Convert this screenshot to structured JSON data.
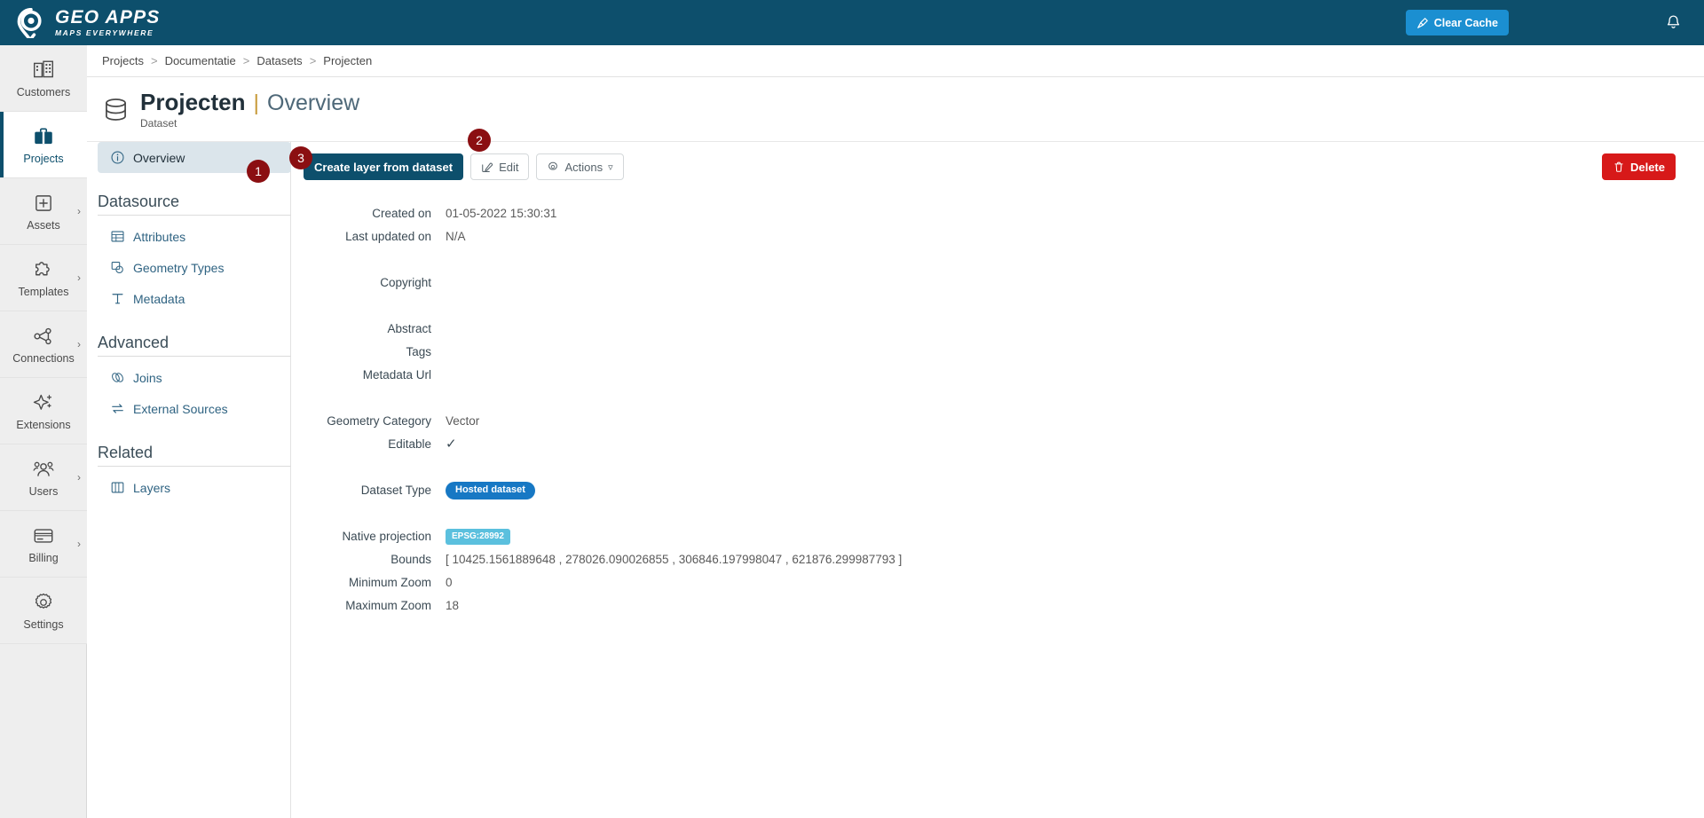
{
  "topbar": {
    "logo_main": "GEO APPS",
    "logo_sub": "MAPS EVERYWHERE",
    "logo_icon": "map-pin-icon",
    "clear_cache_label": "Clear Cache",
    "clear_cache_icon": "broom-icon",
    "clear_cache_color": "#1b8fd1",
    "bell_icon": "notification-bell-icon",
    "background_color": "#0d4f6c"
  },
  "rail": {
    "items": [
      {
        "label": "Customers",
        "icon": "buildings-icon",
        "active": false,
        "chevron": false
      },
      {
        "label": "Projects",
        "icon": "briefcase-icon",
        "active": true,
        "chevron": false
      },
      {
        "label": "Assets",
        "icon": "plus-square-icon",
        "active": false,
        "chevron": true
      },
      {
        "label": "Templates",
        "icon": "puzzle-piece-icon",
        "active": false,
        "chevron": true
      },
      {
        "label": "Connections",
        "icon": "nodes-graph-icon",
        "active": false,
        "chevron": true
      },
      {
        "label": "Extensions",
        "icon": "sparkle-plus-icon",
        "active": false,
        "chevron": false
      },
      {
        "label": "Users",
        "icon": "users-group-icon",
        "active": false,
        "chevron": true
      },
      {
        "label": "Billing",
        "icon": "credit-card-icon",
        "active": false,
        "chevron": true
      },
      {
        "label": "Settings",
        "icon": "gear-icon",
        "active": false,
        "chevron": false
      }
    ]
  },
  "breadcrumb": {
    "separator": ">",
    "items": [
      "Projects",
      "Documentatie",
      "Datasets",
      "Projecten"
    ]
  },
  "page_header": {
    "icon": "database-cylinder-icon",
    "title": "Projecten",
    "divider": "|",
    "section": "Overview",
    "subtitle": "Dataset"
  },
  "subnav": {
    "groups": [
      {
        "heading": null,
        "items": [
          {
            "label": "Overview",
            "icon": "info-circle-icon",
            "active": true
          }
        ]
      },
      {
        "heading": "Datasource",
        "items": [
          {
            "label": "Attributes",
            "icon": "table-icon",
            "active": false
          },
          {
            "label": "Geometry Types",
            "icon": "shapes-icon",
            "active": false
          },
          {
            "label": "Metadata",
            "icon": "text-t-icon",
            "active": false
          }
        ]
      },
      {
        "heading": "Advanced",
        "items": [
          {
            "label": "Joins",
            "icon": "link-chain-icon",
            "active": false
          },
          {
            "label": "External Sources",
            "icon": "exchange-arrows-icon",
            "active": false
          }
        ]
      },
      {
        "heading": "Related",
        "items": [
          {
            "label": "Layers",
            "icon": "layers-icon",
            "active": false
          }
        ]
      }
    ]
  },
  "toolbar": {
    "create_layer_label": "Create layer from dataset",
    "edit_label": "Edit",
    "edit_icon": "pencil-square-icon",
    "actions_label": "Actions",
    "actions_icon": "gear-icon",
    "actions_caret": "▿",
    "delete_label": "Delete",
    "delete_icon": "trash-icon",
    "delete_color": "#d71919",
    "primary_color": "#0d4f6c"
  },
  "badges": [
    {
      "id": "badge1",
      "text": "1"
    },
    {
      "id": "badge2",
      "text": "2"
    },
    {
      "id": "badge3",
      "text": "3"
    }
  ],
  "details": {
    "created_on_label": "Created on",
    "created_on_value": "01-05-2022 15:30:31",
    "last_updated_label": "Last updated on",
    "last_updated_value": "N/A",
    "copyright_label": "Copyright",
    "copyright_value": "",
    "abstract_label": "Abstract",
    "abstract_value": "",
    "tags_label": "Tags",
    "tags_value": "",
    "metadata_url_label": "Metadata Url",
    "metadata_url_value": "",
    "geometry_category_label": "Geometry Category",
    "geometry_category_value": "Vector",
    "editable_label": "Editable",
    "editable_value": "✓",
    "dataset_type_label": "Dataset Type",
    "dataset_type_value": "Hosted dataset",
    "dataset_type_color": "#1778c4",
    "native_projection_label": "Native projection",
    "native_projection_value": "EPSG:28992",
    "native_projection_color": "#5bc0de",
    "bounds_label": "Bounds",
    "bounds_value": "[ 10425.1561889648 , 278026.090026855 , 306846.197998047 , 621876.299987793 ]",
    "minimum_zoom_label": "Minimum Zoom",
    "minimum_zoom_value": "0",
    "maximum_zoom_label": "Maximum Zoom",
    "maximum_zoom_value": "18"
  }
}
